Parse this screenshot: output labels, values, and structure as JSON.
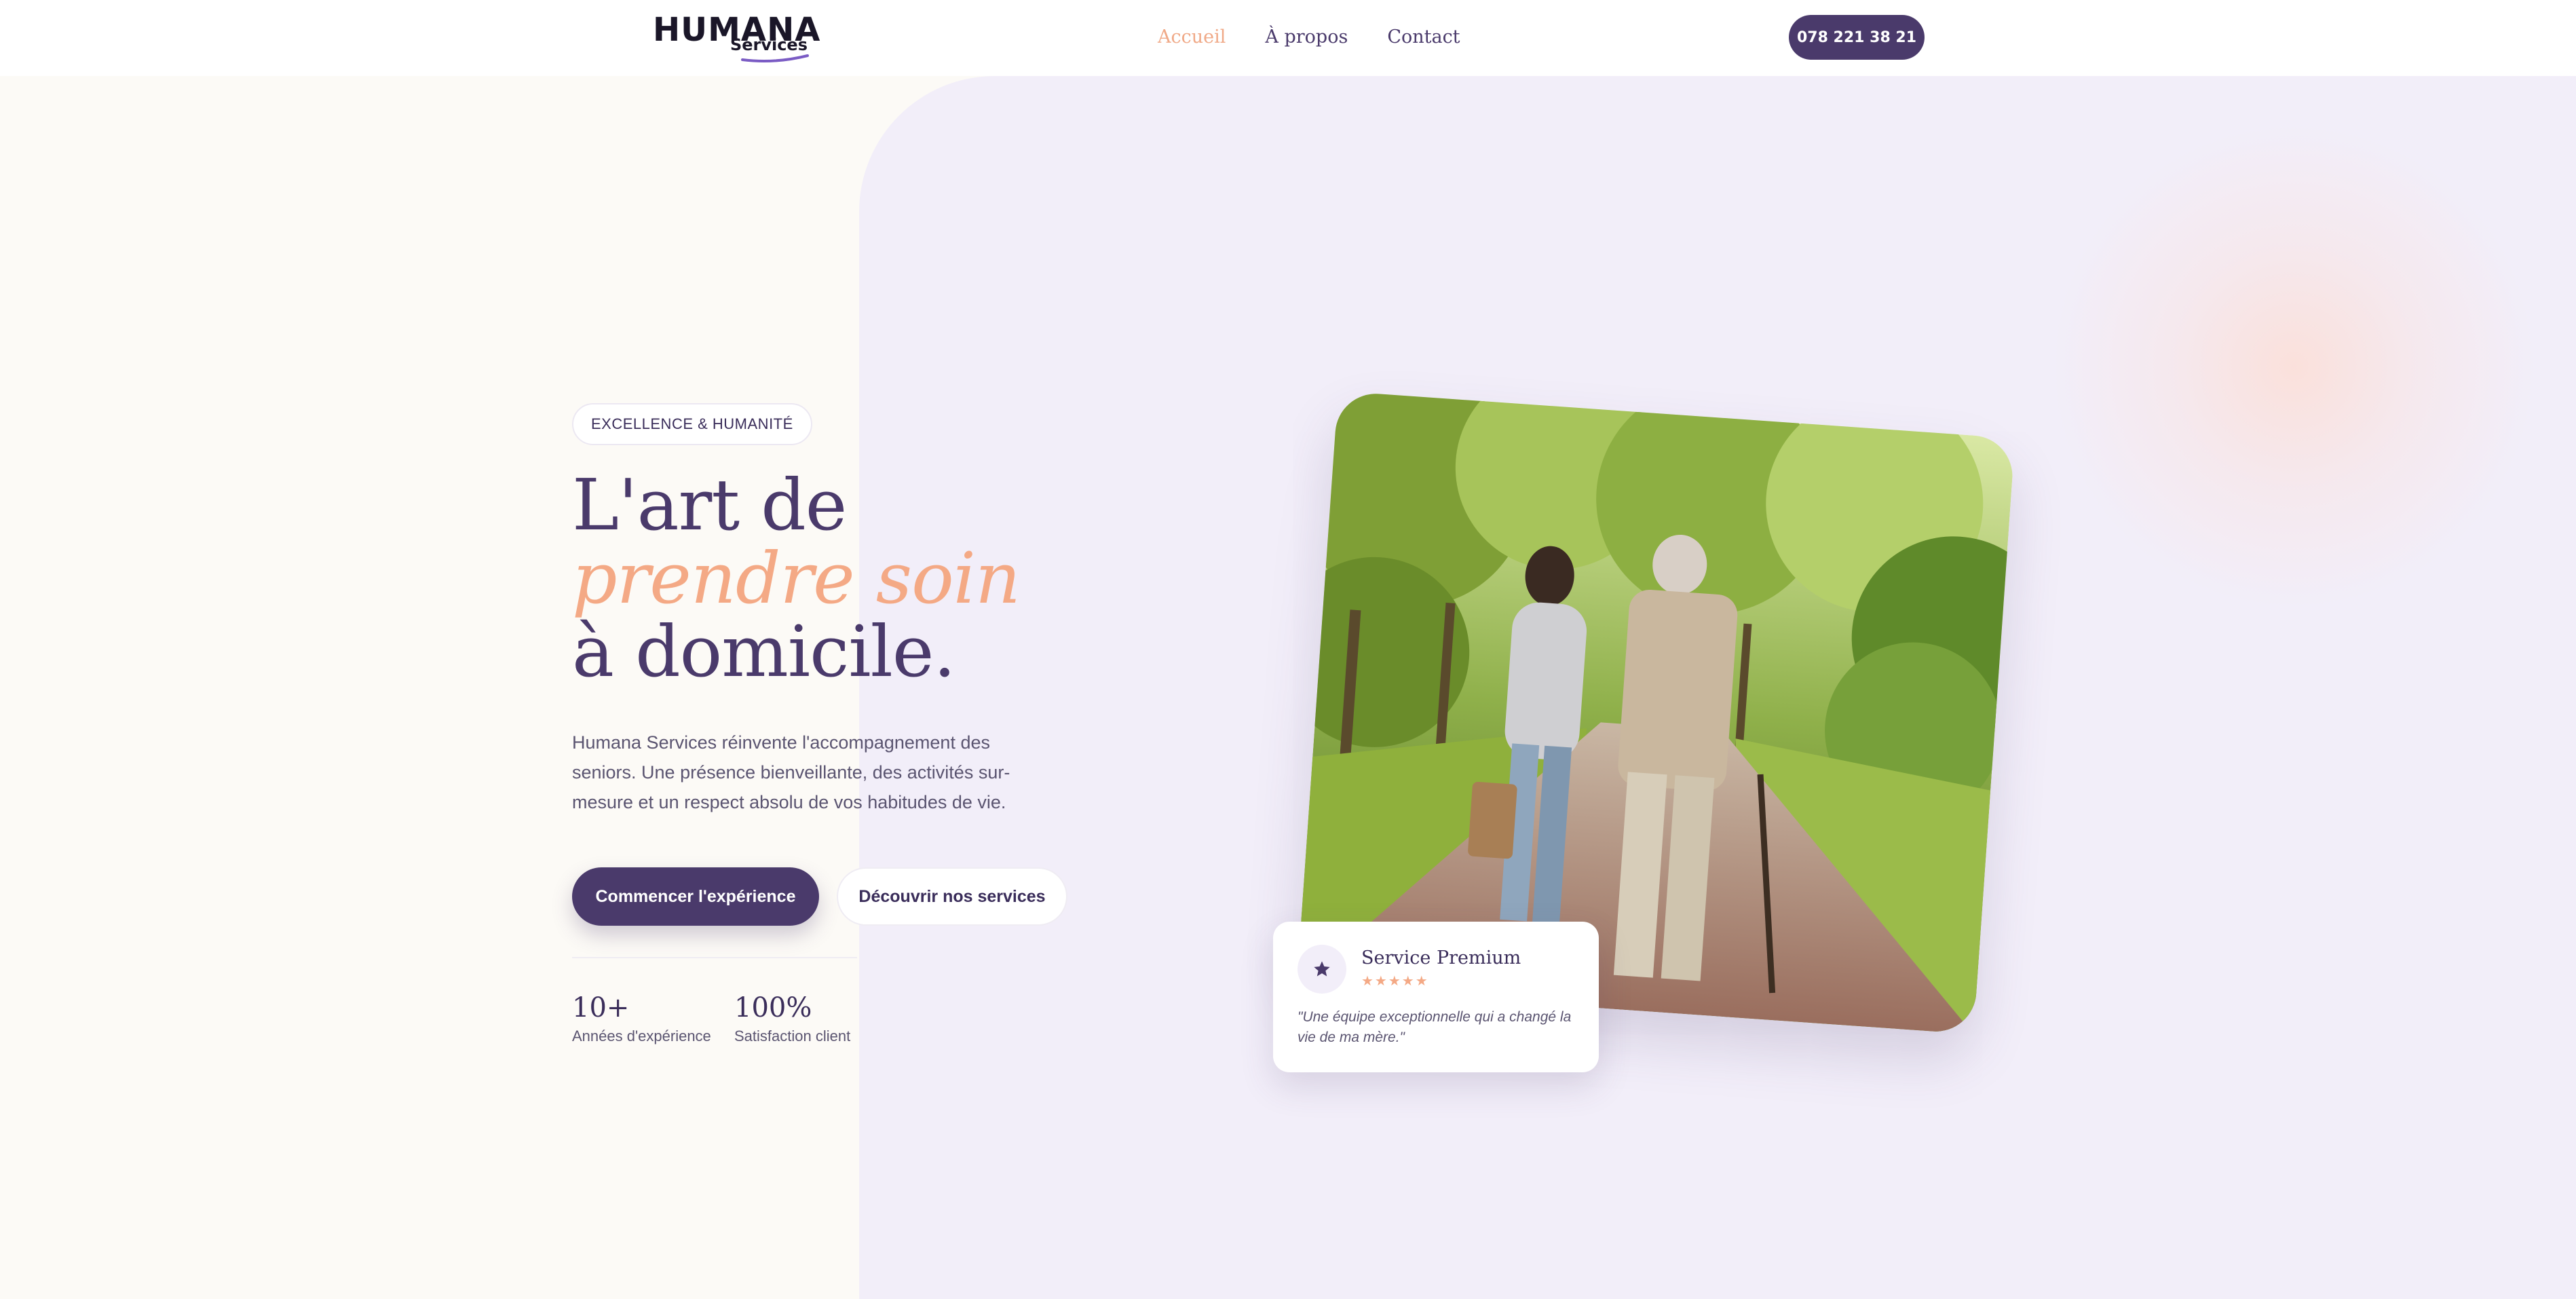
{
  "brand": {
    "name_main": "HUMANA",
    "name_sub": "Services",
    "colors": {
      "primary": "#4a3a6b",
      "accent": "#f4a985",
      "lavender": "#f2eef9"
    }
  },
  "nav": {
    "links": [
      {
        "label": "Accueil",
        "active": true
      },
      {
        "label": "À propos",
        "active": false
      },
      {
        "label": "Contact",
        "active": false
      }
    ],
    "phone": "078 221 38 21"
  },
  "hero": {
    "badge": "EXCELLENCE & HUMANITÉ",
    "title_line1": "L'art de",
    "title_line2": "prendre soin",
    "title_line3": "à domicile.",
    "description": "Humana Services réinvente l'accompagnement des seniors. Une présence bienveillante, des activités sur-mesure et un respect absolu de vos habitudes de vie.",
    "cta_primary": "Commencer l'expérience",
    "cta_secondary": "Découvrir nos services",
    "stats": [
      {
        "value": "10+",
        "label": "Années d'expérience"
      },
      {
        "value": "100%",
        "label": "Satisfaction client"
      }
    ]
  },
  "review": {
    "icon": "star-icon",
    "title": "Service Premium",
    "stars": "★★★★★",
    "rating": 5,
    "quote": "\"Une équipe exceptionnelle qui a changé la vie de ma mère.\""
  },
  "photo": {
    "subject": "caregiver-walking-with-elderly-man-photo"
  }
}
